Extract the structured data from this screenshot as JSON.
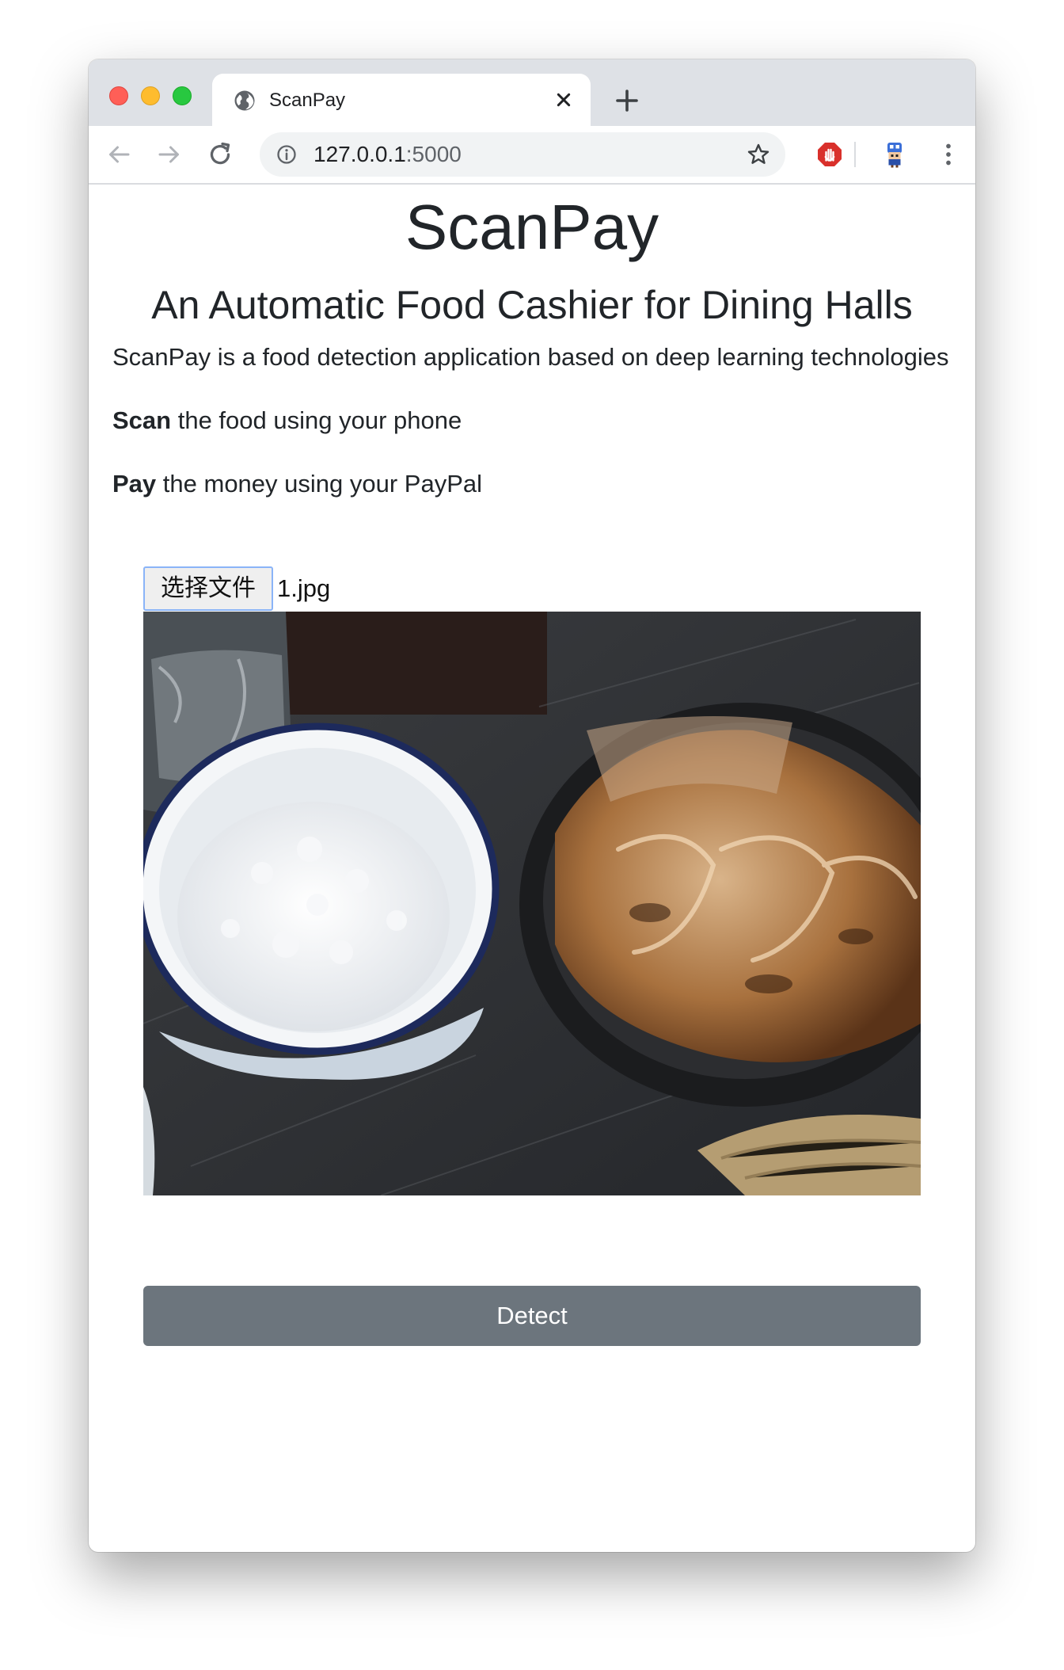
{
  "browser": {
    "tab_title": "ScanPay",
    "url_host": "127.0.0.1",
    "url_port": ":5000"
  },
  "page": {
    "title": "ScanPay",
    "subtitle": "An Automatic Food Cashier for Dining Halls",
    "description": "ScanPay is a food detection application based on deep learning technologies",
    "scan_line": {
      "bold": "Scan",
      "rest": " the food using your phone"
    },
    "pay_line": {
      "bold": "Pay",
      "rest": " the money using your PayPal"
    },
    "file_input": {
      "button_label": "选择文件",
      "file_name": "1.jpg"
    },
    "detect_label": "Detect"
  }
}
